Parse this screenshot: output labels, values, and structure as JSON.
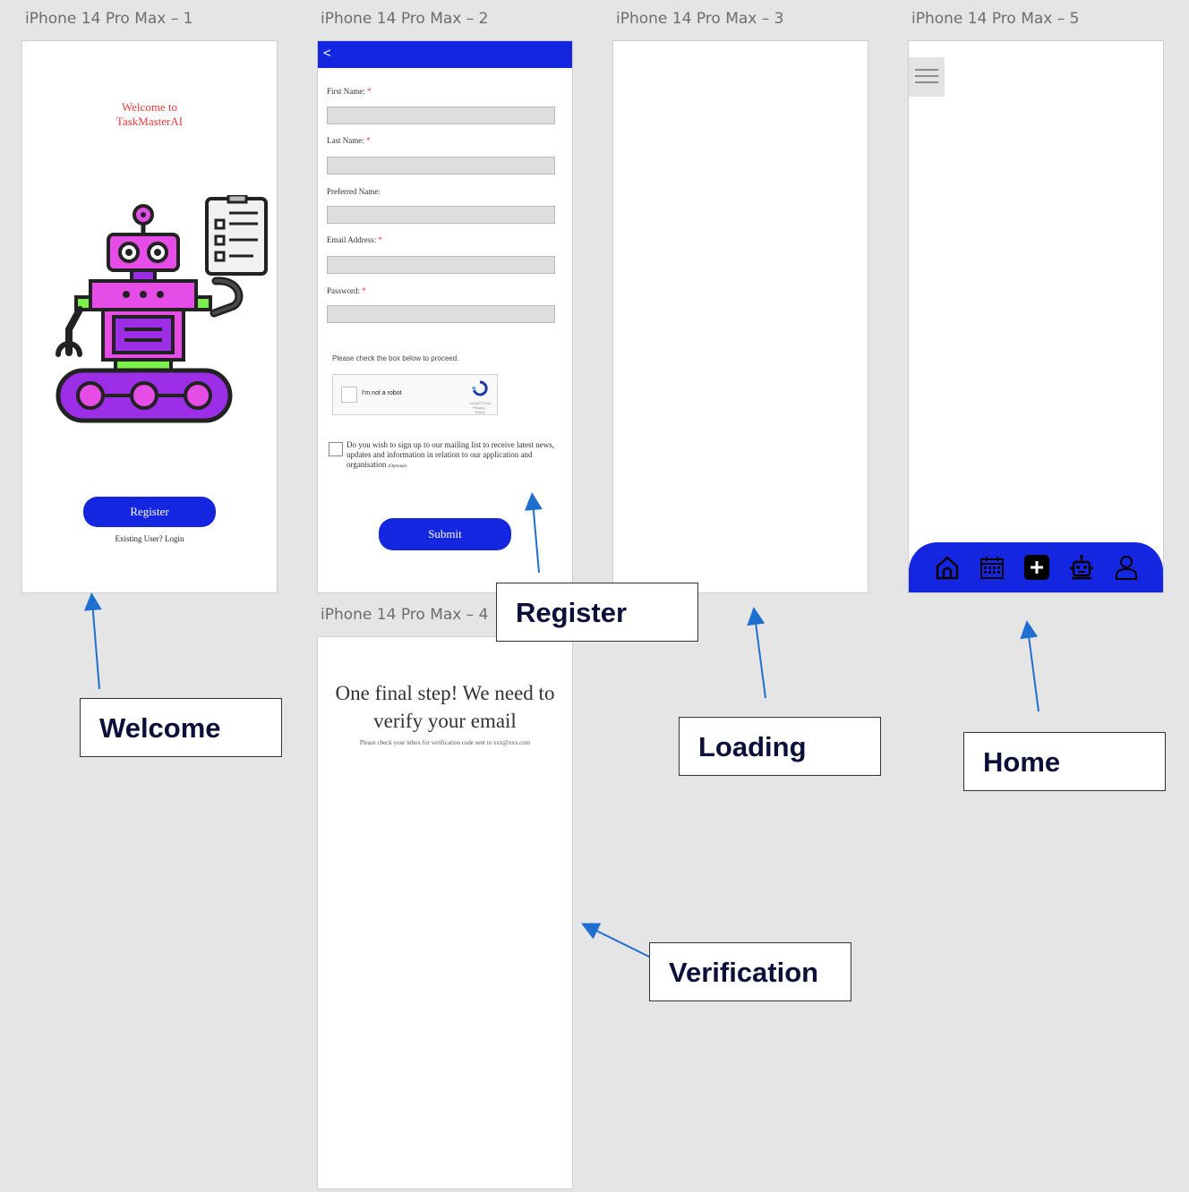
{
  "artboards": {
    "a1": "iPhone 14 Pro Max – 1",
    "a2": "iPhone 14 Pro Max – 2",
    "a3": "iPhone 14 Pro Max – 3",
    "a4": "iPhone 14 Pro Max – 4",
    "a5": "iPhone 14 Pro Max – 5"
  },
  "welcome": {
    "title_line1": "Welcome to",
    "title_line2": "TaskMasterAI",
    "register_button": "Register",
    "login_link": "Existing User? Login",
    "robot_icon": "robot-with-checklist-illustration"
  },
  "register": {
    "back_label": "<",
    "fields": [
      {
        "label": "First Name:",
        "required": "*"
      },
      {
        "label": "Last Name:",
        "required": "*"
      },
      {
        "label": "Preferred Name:",
        "required": ""
      },
      {
        "label": "Email Address:",
        "required": "*"
      },
      {
        "label": "Password:",
        "required": "*"
      }
    ],
    "captcha_prompt": "Please check the box below to proceed.",
    "captcha_label": "I'm not a robot",
    "captcha_brand": "reCAPTCHA",
    "captcha_links": "Privacy - Terms",
    "mailing_text": "Do you wish to sign up to our mailing list to receive latest news, updates and information in relation to our application and organisation",
    "mailing_optional": "(Optional)",
    "submit_button": "Submit"
  },
  "verification": {
    "title": "One final step! We need to verify your email",
    "subtitle": "Please check your inbox for verification code sent to xxx@xxx.com"
  },
  "home": {
    "menu_icon": "hamburger-menu-icon",
    "nav_icons": [
      "home-icon",
      "calendar-icon",
      "add-icon",
      "robot-icon",
      "profile-icon"
    ]
  },
  "annotations": {
    "welcome": "Welcome",
    "register": "Register",
    "loading": "Loading",
    "home": "Home",
    "verification": "Verification"
  },
  "colors": {
    "brand_blue": "#1426e0",
    "accent_red": "#ec3b3b",
    "annotation_arrow": "#1f6fd1",
    "robot_magenta": "#e64ce6",
    "robot_purple": "#9b2ee6"
  }
}
